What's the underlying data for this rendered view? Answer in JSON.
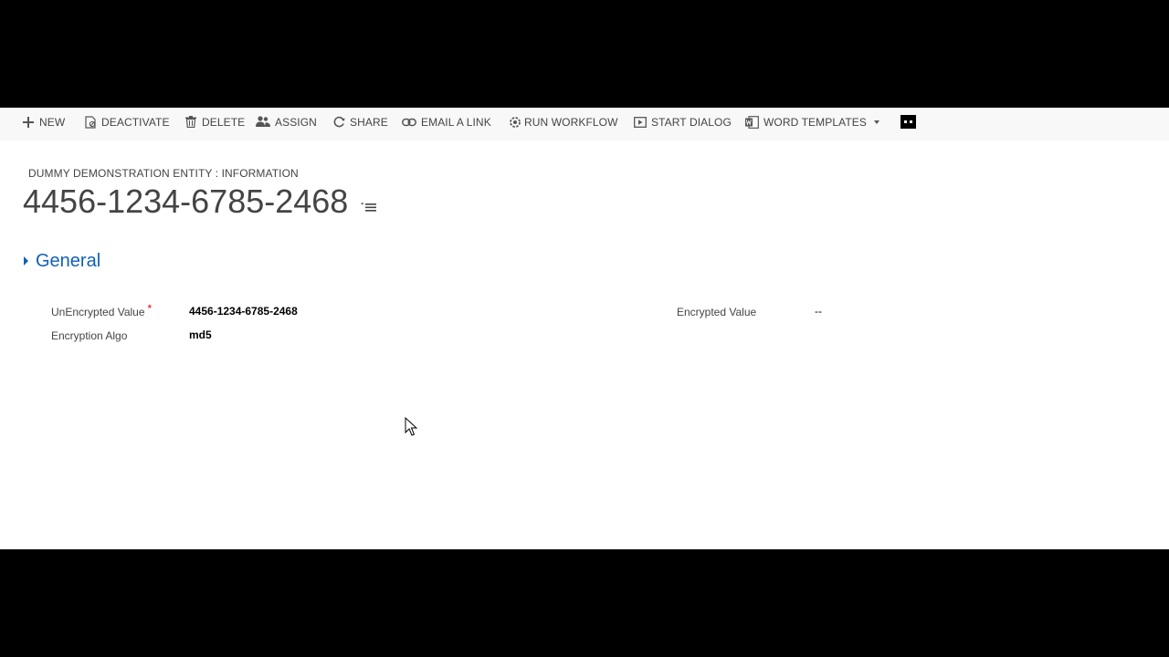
{
  "command_bar": {
    "items": [
      {
        "label": "NEW",
        "icon": "plus-icon"
      },
      {
        "label": "DEACTIVATE",
        "icon": "deactivate-icon"
      },
      {
        "label": "DELETE",
        "icon": "trash-icon"
      },
      {
        "label": "ASSIGN",
        "icon": "assign-icon"
      },
      {
        "label": "SHARE",
        "icon": "share-icon"
      },
      {
        "label": "EMAIL A LINK",
        "icon": "link-icon"
      },
      {
        "label": "RUN WORKFLOW",
        "icon": "workflow-icon"
      },
      {
        "label": "START DIALOG",
        "icon": "dialog-icon"
      },
      {
        "label": "WORD TEMPLATES",
        "icon": "word-icon"
      }
    ],
    "overflow_icon": "more-icon"
  },
  "header": {
    "entity_label": "DUMMY DEMONSTRATION ENTITY : INFORMATION",
    "record_title": "4456-1234-6785-2468"
  },
  "section": {
    "title": "General",
    "fields": {
      "unencrypted_label": "UnEncrypted Value",
      "unencrypted_required": "*",
      "unencrypted_value": "4456-1234-6785-2468",
      "algo_label": "Encryption Algo",
      "algo_value": "md5",
      "encrypted_label": "Encrypted Value",
      "encrypted_value": "--"
    }
  },
  "colors": {
    "accent": "#1160b7",
    "required": "#e00000",
    "text": "#444444"
  }
}
